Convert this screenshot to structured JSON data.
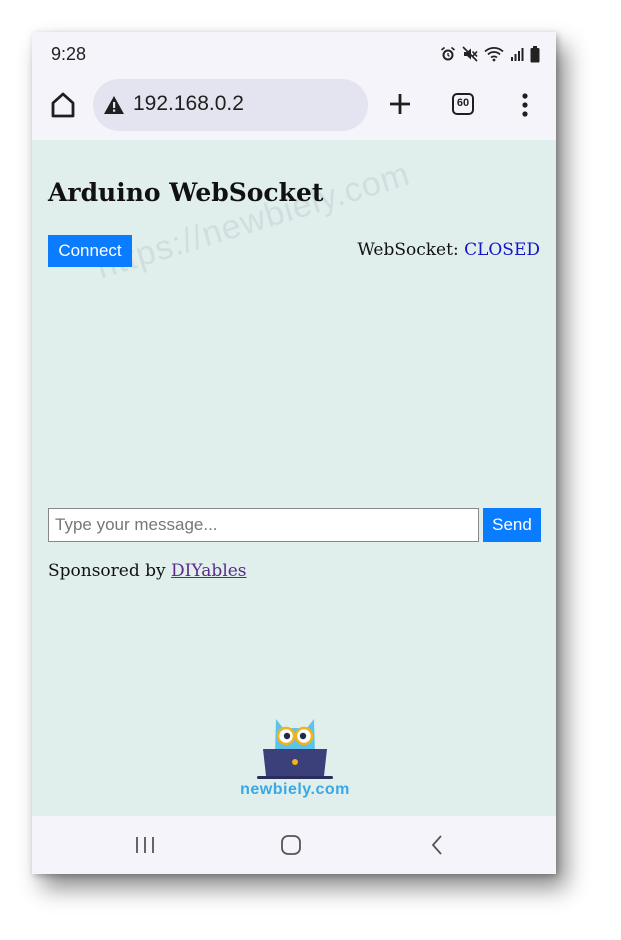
{
  "status_bar": {
    "time": "9:28",
    "icons": [
      "alarm-icon",
      "mute-icon",
      "wifi-icon",
      "signal-icon",
      "battery-icon"
    ]
  },
  "browser": {
    "url": "192.168.0.2",
    "tab_count": "60",
    "icons": [
      "home-icon",
      "warning-icon",
      "new-tab-icon",
      "tabs-icon",
      "menu-icon"
    ]
  },
  "page": {
    "watermark": "https://newbiely.com",
    "title": "Arduino WebSocket",
    "connect_label": "Connect",
    "ws_label": "WebSocket:",
    "ws_state": "CLOSED",
    "message_placeholder": "Type your message...",
    "send_label": "Send",
    "sponsor_prefix": "Sponsored by",
    "sponsor_link": "DIYables",
    "logo_text": "newbiely.com"
  },
  "nav_bar": {
    "icons": [
      "recent-apps-icon",
      "home-nav-icon",
      "back-icon"
    ]
  },
  "colors": {
    "accent": "#0a7cff",
    "page_bg": "#e0eeec",
    "ws_state": "#1414c8",
    "link": "#5b2a8a",
    "chrome_bg": "#f6f4fb",
    "url_bar": "#e3e4ef"
  }
}
